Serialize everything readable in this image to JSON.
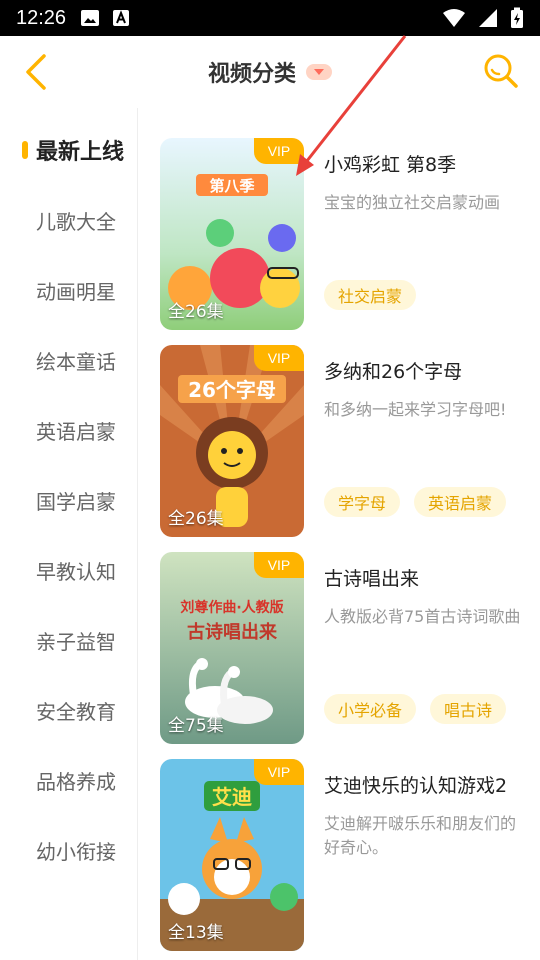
{
  "status_bar": {
    "time": "12:26"
  },
  "header": {
    "title": "视频分类"
  },
  "sidebar": {
    "items": [
      {
        "label": "最新上线",
        "active": true
      },
      {
        "label": "儿歌大全"
      },
      {
        "label": "动画明星"
      },
      {
        "label": "绘本童话"
      },
      {
        "label": "英语启蒙"
      },
      {
        "label": "国学启蒙"
      },
      {
        "label": "早教认知"
      },
      {
        "label": "亲子益智"
      },
      {
        "label": "安全教育"
      },
      {
        "label": "品格养成"
      },
      {
        "label": "幼小衔接"
      }
    ]
  },
  "cards": [
    {
      "title": "小鸡彩虹 第8季",
      "desc": "宝宝的独立社交启蒙动画",
      "episodes": "全26集",
      "vip": "VIP",
      "thumb_text": "第八季",
      "tags": [
        "社交启蒙"
      ]
    },
    {
      "title": "多纳和26个字母",
      "desc": "和多纳一起来学习字母吧!",
      "episodes": "全26集",
      "vip": "VIP",
      "thumb_text": "26个字母",
      "tags": [
        "学字母",
        "英语启蒙"
      ]
    },
    {
      "title": "古诗唱出来",
      "desc": "人教版必背75首古诗词歌曲",
      "episodes": "全75集",
      "vip": "VIP",
      "thumb_text": "刘尊作曲·人教版",
      "thumb_text2": "古诗唱出来",
      "tags": [
        "小学必备",
        "唱古诗"
      ]
    },
    {
      "title": "艾迪快乐的认知游戏2",
      "desc": "艾迪解开啵乐乐和朋友们的好奇心。",
      "episodes": "全13集",
      "vip": "VIP",
      "thumb_text": "艾迪",
      "tags": []
    }
  ],
  "colors": {
    "accent": "#ffb400",
    "arrow": "#e8403a"
  }
}
